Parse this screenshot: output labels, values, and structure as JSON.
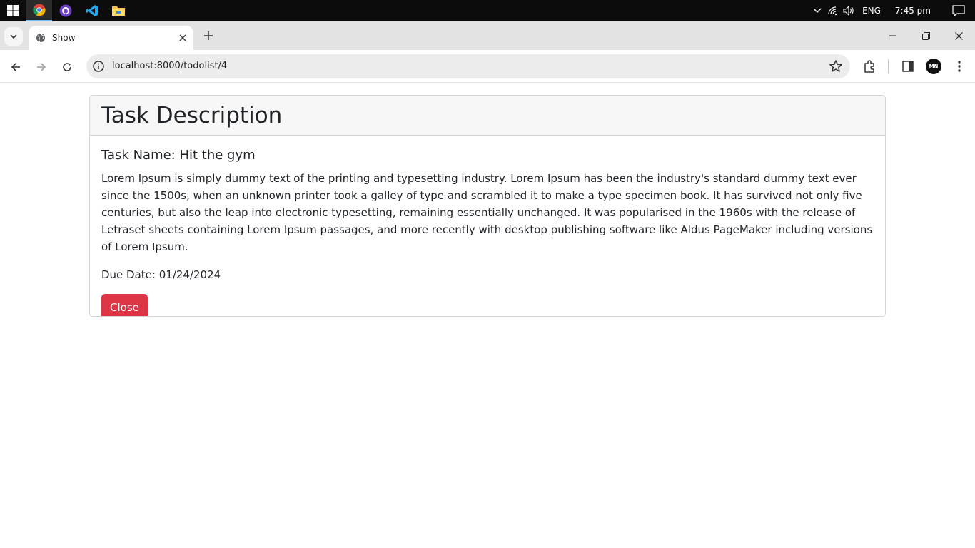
{
  "taskbar": {
    "apps": [
      "chrome-icon",
      "github-desktop-icon",
      "vscode-icon",
      "file-explorer-icon"
    ],
    "language": "ENG",
    "time": "7:45 pm"
  },
  "browser": {
    "tab_title": "Show",
    "url": "localhost:8000/todolist/4",
    "profile_initials": "MN"
  },
  "page": {
    "heading": "Task Description",
    "task_name": "Task Name: Hit the gym",
    "description": "Lorem Ipsum is simply dummy text of the printing and typesetting industry. Lorem Ipsum has been the industry's standard dummy text ever since the 1500s, when an unknown printer took a galley of type and scrambled it to make a type specimen book. It has survived not only five centuries, but also the leap into electronic typesetting, remaining essentially unchanged. It was popularised in the 1960s with the release of Letraset sheets containing Lorem Ipsum passages, and more recently with desktop publishing software like Aldus PageMaker including versions of Lorem Ipsum.",
    "due_date": "Due Date: 01/24/2024",
    "close_label": "Close"
  },
  "colors": {
    "danger": "#dc3545",
    "card_header_bg": "#f7f7f7",
    "taskbar_bg": "#0c0c0c"
  }
}
